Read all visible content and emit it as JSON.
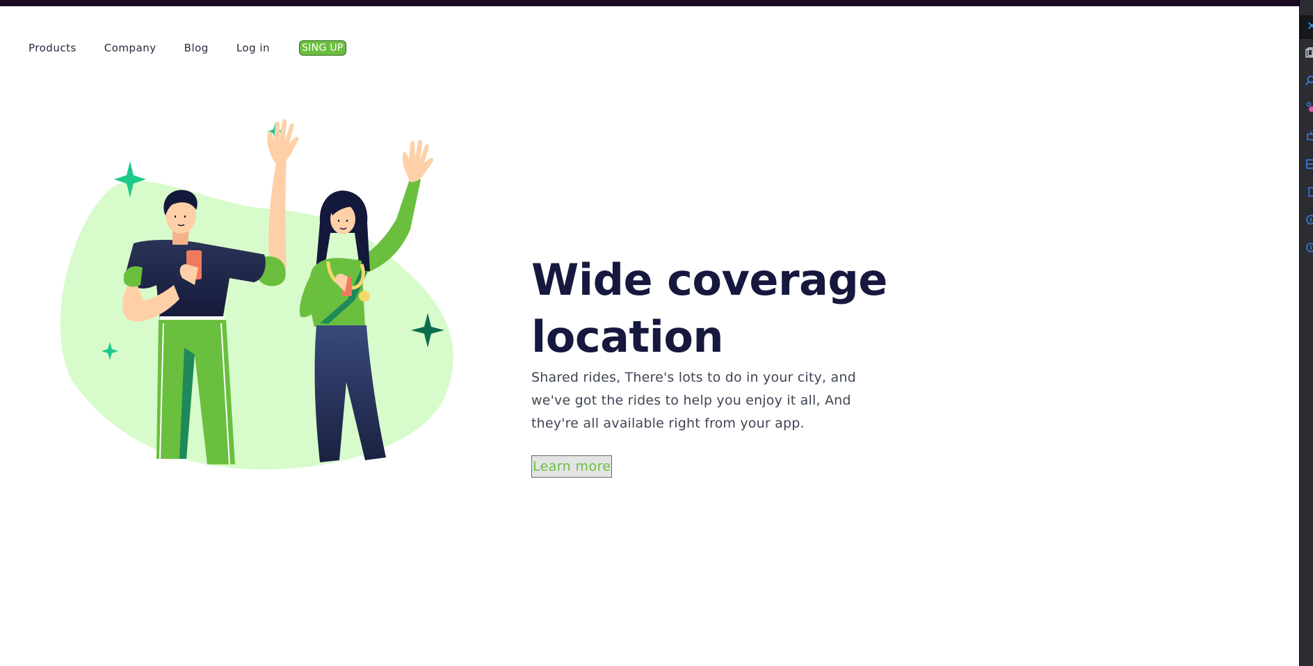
{
  "nav": {
    "products": "Products",
    "company": "Company",
    "blog": "Blog",
    "login": "Log in",
    "signup": "SING UP"
  },
  "hero": {
    "title": "Wide coverage location",
    "description": "Shared rides, There's lots to do in your city, and we've got the rides to help you enjoy it all, And they're all available right from your app.",
    "learn_more": "Learn more"
  },
  "illustration": {
    "subject": "two-people-waving-with-phones"
  },
  "devtools_panel": {
    "icons": [
      "close-icon",
      "copy-icon",
      "search-icon",
      "extensions-icon",
      "robot-icon",
      "layout-icon",
      "panel-icon",
      "info-icon",
      "info-icon-2"
    ]
  },
  "colors": {
    "accent_green": "#6abf3f",
    "headline_navy": "#16183e",
    "blob_green": "#d8fbcc",
    "sparkle_teal": "#1ec98a",
    "top_strip": "#1a0b24"
  }
}
